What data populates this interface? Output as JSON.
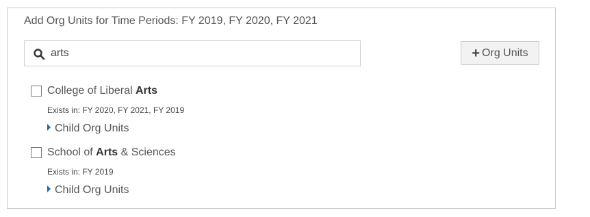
{
  "panel": {
    "title": "Add Org Units for Time Periods: FY 2019, FY 2020, FY 2021"
  },
  "search": {
    "value": "arts",
    "icon": "search-icon"
  },
  "add_button": {
    "label": "Org Units",
    "icon": "plus-icon"
  },
  "results": [
    {
      "name_before": "College of Liberal ",
      "name_match": "Arts",
      "name_after": "",
      "exists": "Exists in: FY 2020, FY 2021, FY 2019",
      "child_label": "Child Org Units",
      "checked": false
    },
    {
      "name_before": "School of ",
      "name_match": "Arts",
      "name_after": " & Sciences",
      "exists": "Exists in: FY 2019",
      "child_label": "Child Org Units",
      "checked": false
    }
  ],
  "colors": {
    "caret": "#2266aa",
    "border": "#c8c8c8"
  }
}
